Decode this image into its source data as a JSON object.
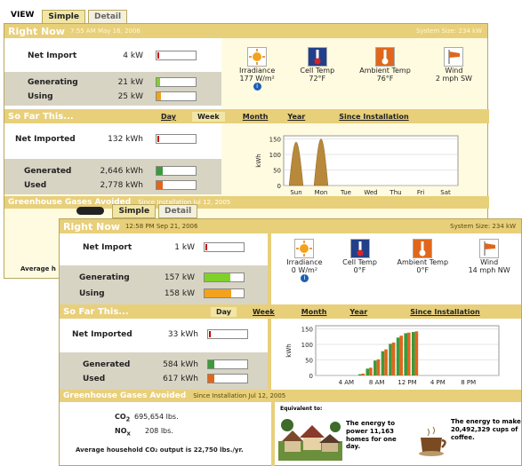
{
  "back": {
    "view_label": "VIEW",
    "tabs": [
      "Simple",
      "Detail"
    ],
    "right_now": {
      "title": "Right Now",
      "timestamp": "7:55 AM May 16, 2006",
      "system_size": "System Size: 234 kW"
    },
    "net_import": {
      "label": "Net Import",
      "value": "4 kW",
      "fraction": 0.02
    },
    "generating": {
      "label": "Generating",
      "value": "21 kW",
      "fraction": 0.1
    },
    "using": {
      "label": "Using",
      "value": "25 kW",
      "fraction": 0.12
    },
    "sensors": [
      {
        "label": "Irradiance",
        "value": "177 W/m²",
        "icon": "sun-icon"
      },
      {
        "label": "Cell Temp",
        "value": "72°F",
        "icon": "thermometer-icon"
      },
      {
        "label": "Ambient Temp",
        "value": "76°F",
        "icon": "thermometer-icon"
      },
      {
        "label": "Wind",
        "value": "2 mph SW",
        "icon": "windsock-icon"
      }
    ],
    "so_far": {
      "title": "So Far This...",
      "periods": [
        "Day",
        "Week",
        "Month",
        "Year",
        "Since Installation"
      ],
      "active": "Week"
    },
    "net_imported": {
      "label": "Net Imported",
      "value": "132 kWh",
      "fraction": 0.04
    },
    "generated": {
      "label": "Generated",
      "value": "2,646 kWh",
      "fraction": 0.15
    },
    "used": {
      "label": "Used",
      "value": "2,778 kWh",
      "fraction": 0.16
    },
    "greenhouse": {
      "title": "Greenhouse Gases Avoided",
      "since": "Since Installation Jul 12, 2005"
    },
    "average_fragment": "Average h"
  },
  "front": {
    "view_label": "VIEW",
    "tabs": [
      "Simple",
      "Detail"
    ],
    "right_now": {
      "title": "Right Now",
      "timestamp": "12:58 PM Sep 21, 2006",
      "system_size": "System Size: 234 kW"
    },
    "net_import": {
      "label": "Net Import",
      "value": "1 kW",
      "fraction": 0.01
    },
    "generating": {
      "label": "Generating",
      "value": "157 kW",
      "fraction": 0.67
    },
    "using": {
      "label": "Using",
      "value": "158 kW",
      "fraction": 0.68
    },
    "sensors": [
      {
        "label": "Irradiance",
        "value": "0 W/m²",
        "icon": "sun-icon"
      },
      {
        "label": "Cell Temp",
        "value": "0°F",
        "icon": "thermometer-icon"
      },
      {
        "label": "Ambient Temp",
        "value": "0°F",
        "icon": "thermometer-icon"
      },
      {
        "label": "Wind",
        "value": "14 mph NW",
        "icon": "windsock-icon"
      }
    ],
    "so_far": {
      "title": "So Far This...",
      "periods": [
        "Day",
        "Week",
        "Month",
        "Year",
        "Since Installation"
      ],
      "active": "Day"
    },
    "net_imported": {
      "label": "Net Imported",
      "value": "33 kWh",
      "fraction": 0.02
    },
    "generated": {
      "label": "Generated",
      "value": "584 kWh",
      "fraction": 0.15
    },
    "used": {
      "label": "Used",
      "value": "617 kWh",
      "fraction": 0.16
    },
    "greenhouse": {
      "title": "Greenhouse Gases Avoided",
      "since": "Since Installation Jul 12, 2005",
      "co2": "695,654 lbs.",
      "nox": "208 lbs.",
      "average": "Average household CO₂ output is 22,750 lbs./yr.",
      "equivalent_label": "Equivalent to:",
      "homes_text": "The energy to power 11,163 homes for one day.",
      "coffee_text": "The energy to make 20,492,329 cups of coffee."
    }
  },
  "colors": {
    "header_yellow": "#e8cf7a",
    "generating_green": "#7fd12a",
    "using_orange": "#f2a21c",
    "bar_green": "#3c9a3c",
    "bar_orange": "#e0661c",
    "bar_brown": "#b8893a"
  },
  "chart_data": [
    {
      "type": "area",
      "ylabel": "kWh",
      "yticks": [
        0,
        50,
        100,
        150
      ],
      "ylim": [
        0,
        160
      ],
      "categories": [
        "Sun",
        "Mon",
        "Tue",
        "Wed",
        "Thu",
        "Fri",
        "Sat"
      ],
      "series": [
        {
          "values": [
            140,
            150,
            0,
            0,
            0,
            0,
            0
          ]
        }
      ]
    },
    {
      "type": "bar",
      "ylabel": "kWh",
      "yticks": [
        0,
        50,
        100,
        150
      ],
      "ylim": [
        0,
        160
      ],
      "xticks": [
        "4 AM",
        "8 AM",
        "12 PM",
        "4 PM",
        "8 PM"
      ],
      "x": [
        6,
        7,
        8,
        9,
        10,
        11,
        12,
        13
      ],
      "series": [
        {
          "values": [
            4,
            22,
            48,
            78,
            102,
            122,
            136,
            140
          ]
        },
        {
          "values": [
            6,
            25,
            52,
            84,
            106,
            128,
            138,
            142
          ]
        }
      ]
    }
  ]
}
